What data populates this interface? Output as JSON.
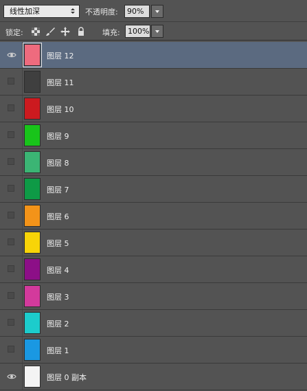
{
  "toolbar": {
    "blend_mode": "线性加深",
    "opacity_label": "不透明度:",
    "opacity_value": "90%"
  },
  "lockbar": {
    "lock_label": "锁定:",
    "fill_label": "填充:",
    "fill_value": "100%"
  },
  "layers": [
    {
      "name": "图层 12",
      "color": "#ee6b7e",
      "visible": true,
      "selected": true
    },
    {
      "name": "图层 11",
      "color": "#3f3f3f",
      "visible": false,
      "selected": false
    },
    {
      "name": "图层 10",
      "color": "#cc1a1f",
      "visible": false,
      "selected": false
    },
    {
      "name": "图层 9",
      "color": "#18c41a",
      "visible": false,
      "selected": false
    },
    {
      "name": "图层 8",
      "color": "#3bb574",
      "visible": false,
      "selected": false
    },
    {
      "name": "图层 7",
      "color": "#0e9a46",
      "visible": false,
      "selected": false
    },
    {
      "name": "图层 6",
      "color": "#f39319",
      "visible": false,
      "selected": false
    },
    {
      "name": "图层 5",
      "color": "#f8d408",
      "visible": false,
      "selected": false
    },
    {
      "name": "图层 4",
      "color": "#8c0f87",
      "visible": false,
      "selected": false
    },
    {
      "name": "图层 3",
      "color": "#d33a9c",
      "visible": false,
      "selected": false
    },
    {
      "name": "图层 2",
      "color": "#1ccccc",
      "visible": false,
      "selected": false
    },
    {
      "name": "图层 1",
      "color": "#1a98e2",
      "visible": false,
      "selected": false
    },
    {
      "name": "图层 0 副本",
      "color": "#f4f4f4",
      "visible": true,
      "selected": false
    }
  ]
}
